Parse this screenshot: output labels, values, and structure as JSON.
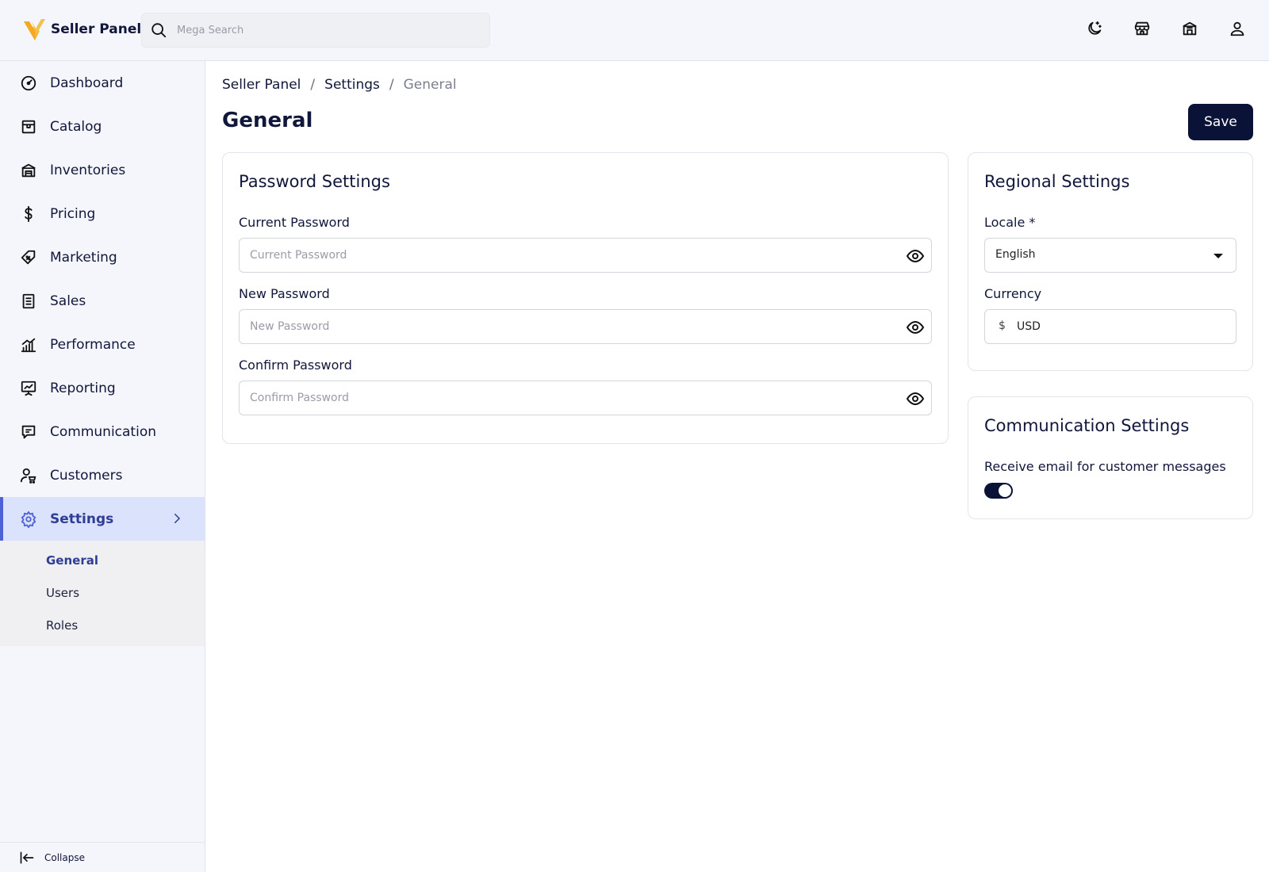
{
  "brand": {
    "name": "Seller Panel"
  },
  "search": {
    "placeholder": "Mega Search"
  },
  "sidebar": {
    "items": [
      {
        "label": "Dashboard"
      },
      {
        "label": "Catalog"
      },
      {
        "label": "Inventories"
      },
      {
        "label": "Pricing"
      },
      {
        "label": "Marketing"
      },
      {
        "label": "Sales"
      },
      {
        "label": "Performance"
      },
      {
        "label": "Reporting"
      },
      {
        "label": "Communication"
      },
      {
        "label": "Customers"
      },
      {
        "label": "Settings"
      }
    ],
    "subitems": [
      {
        "label": "General"
      },
      {
        "label": "Users"
      },
      {
        "label": "Roles"
      }
    ],
    "collapse_label": "Collapse"
  },
  "breadcrumb": {
    "root": "Seller Panel",
    "parent": "Settings",
    "current": "General",
    "separator": "/"
  },
  "page": {
    "title": "General",
    "save_label": "Save"
  },
  "password_settings": {
    "title": "Password Settings",
    "current_label": "Current Password",
    "current_placeholder": "Current Password",
    "new_label": "New Password",
    "new_placeholder": "New Password",
    "confirm_label": "Confirm Password",
    "confirm_placeholder": "Confirm Password"
  },
  "regional_settings": {
    "title": "Regional Settings",
    "locale_label": "Locale *",
    "locale_value": "English",
    "currency_label": "Currency",
    "currency_symbol": "$",
    "currency_value": "USD"
  },
  "communication_settings": {
    "title": "Communication Settings",
    "email_label": "Receive email for customer messages",
    "email_enabled": true
  },
  "colors": {
    "primary": "#0b1238",
    "accent": "#4e62d6",
    "active_bg": "#dbe2fb",
    "sidebar_bg": "#f4f6fc"
  }
}
